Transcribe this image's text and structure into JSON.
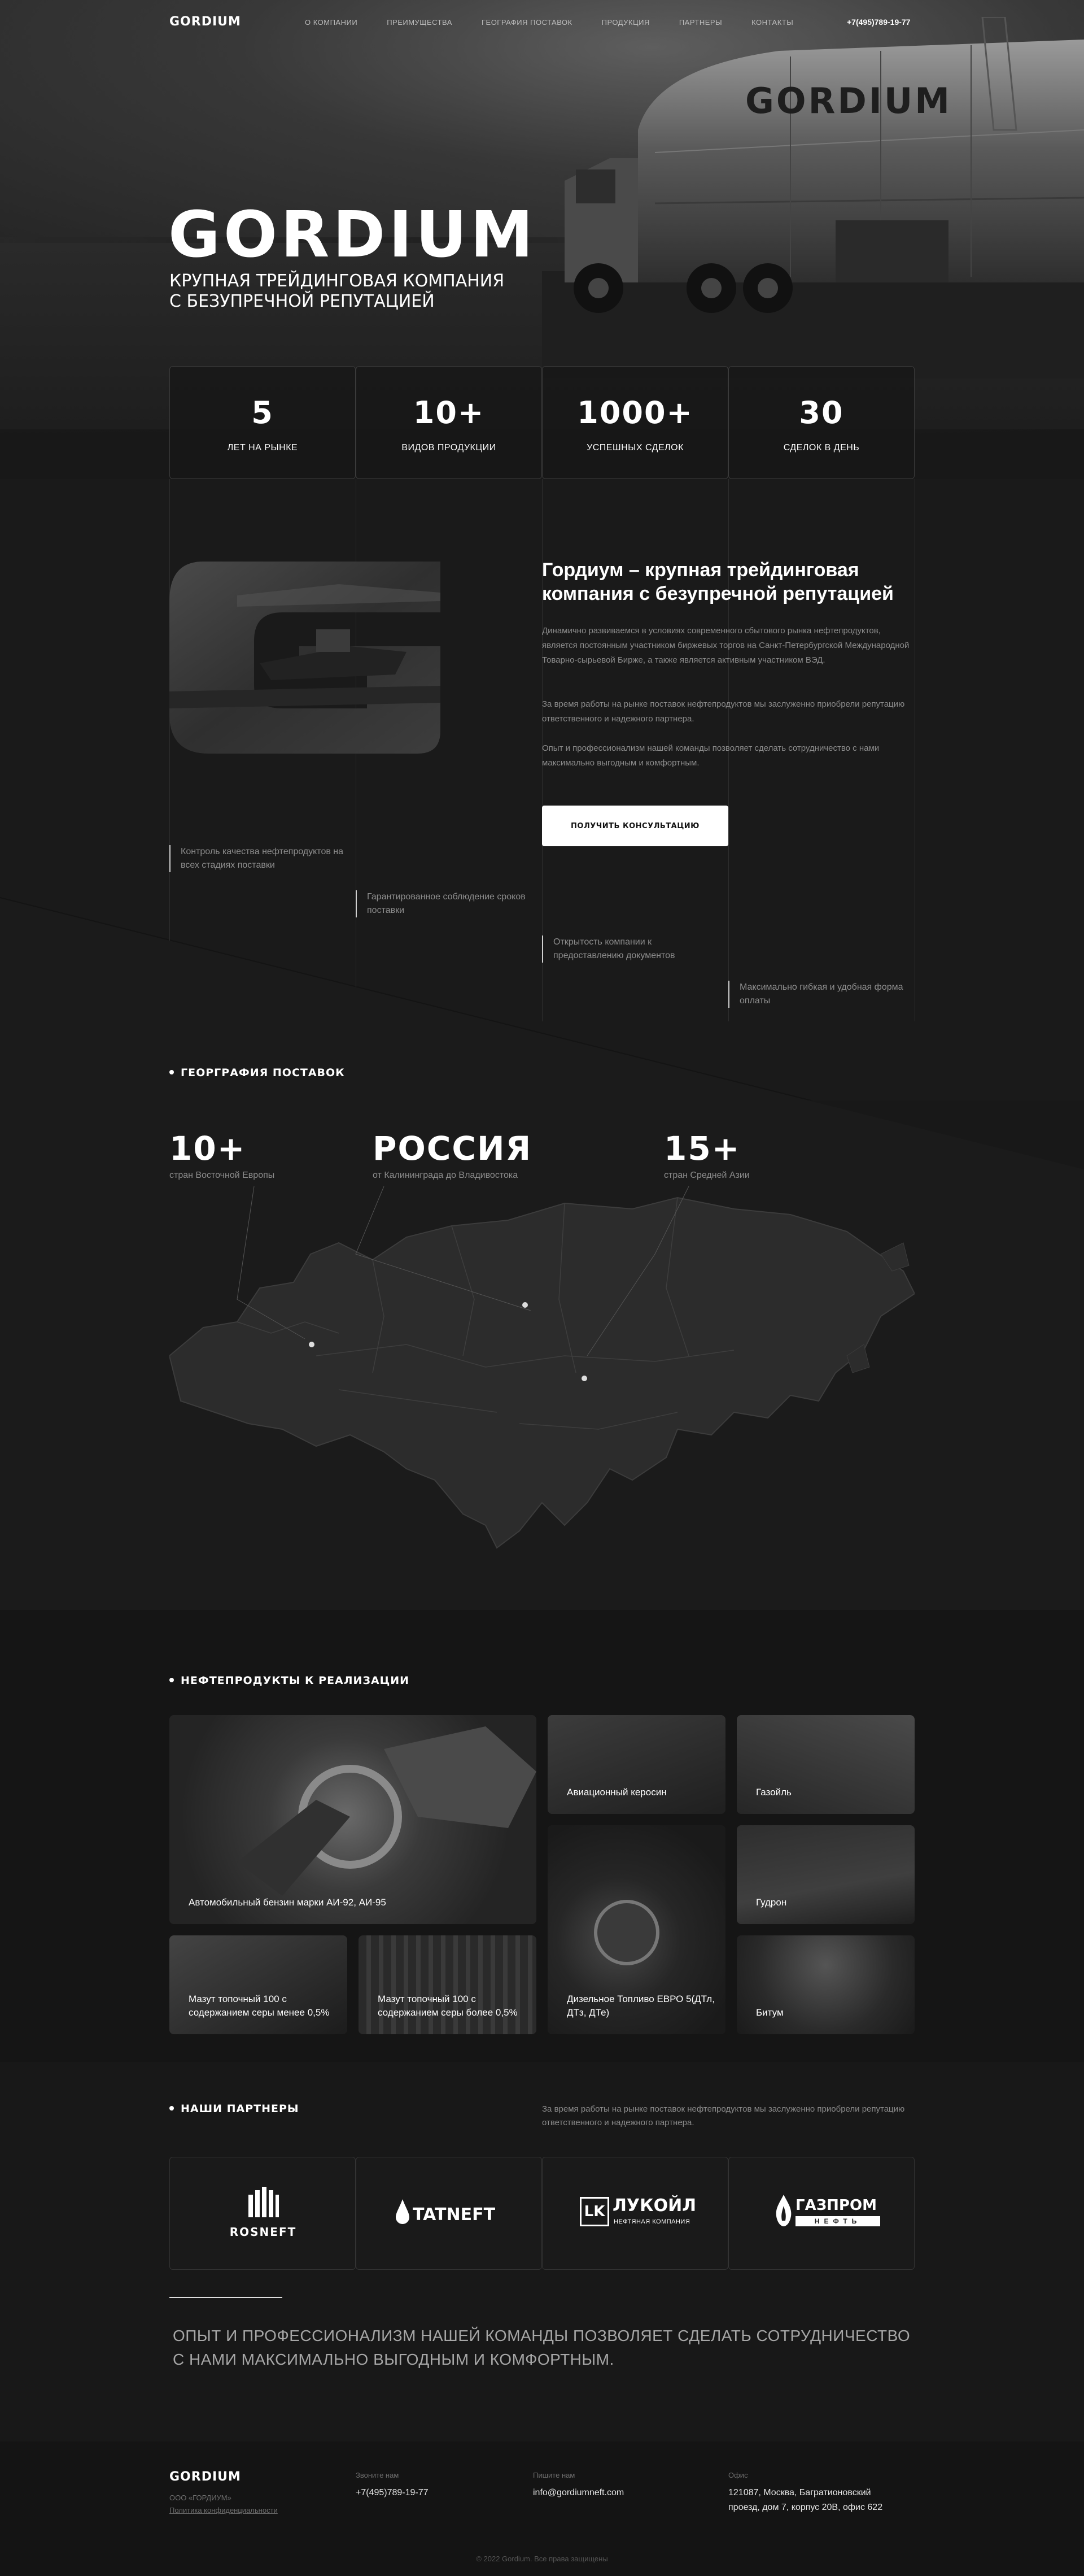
{
  "nav": {
    "logo": "GORDIUM",
    "items": [
      "О КОМПАНИИ",
      "ПРЕИМУЩЕСТВА",
      "ГЕОГРАФИЯ ПОСТАВОК",
      "ПРОДУКЦИЯ",
      "ПАРТНЕРЫ",
      "КОНТАКТЫ"
    ],
    "phone": "+7(495)789-19-77"
  },
  "hero": {
    "title": "GORDIUM",
    "subtitle_line1": "КРУПНАЯ ТРЕЙДИНГОВАЯ КОМПАНИЯ",
    "subtitle_line2": "С БЕЗУПРЕЧНОЙ РЕПУТАЦИЕЙ",
    "truck_brand": "GORDIUM"
  },
  "stats": [
    {
      "value": "5",
      "label": "ЛЕТ НА РЫНКЕ"
    },
    {
      "value": "10+",
      "label": "ВИДОВ ПРОДУКЦИИ"
    },
    {
      "value": "1000+",
      "label": "УСПЕШНЫХ СДЕЛОК"
    },
    {
      "value": "30",
      "label": "СДЕЛОК В ДЕНЬ"
    }
  ],
  "about": {
    "title": "Гордиум – крупная трейдинговая компания с безупречной репутацией",
    "p1": "Динамично развиваемся в условиях современного сбытового рынка нефтепродуктов, является постоянным участником биржевых торгов на Санкт-Петербургской Международной Товарно-сырьевой Бирже, а также является активным участником ВЭД.",
    "p2": "За время работы на рынке поставок нефтепродуктов мы заслуженно приобрели репутацию ответственного и надежного партнера.",
    "p3": "Опыт и профессионализм нашей команды позволяет сделать сотрудничество с нами максимально выгодным и комфортным.",
    "button": "ПОЛУЧИТЬ КОНСУЛЬТАЦИЮ"
  },
  "features": [
    "Контроль качества нефтепродуктов на всех стадиях поставки",
    "Гарантированное соблюдение сроков поставки",
    "Открытость компании к предоставлению документов",
    "Максимально гибкая и удобная форма оплаты"
  ],
  "geography": {
    "title": "ГЕОРГРАФИЯ ПОСТАВОК",
    "items": [
      {
        "value": "10+",
        "caption": "стран Восточной Европы"
      },
      {
        "value": "РОССИЯ",
        "caption": "от Калининграда до Владивостока"
      },
      {
        "value": "15+",
        "caption": "стран Средней Азии"
      }
    ]
  },
  "products": {
    "title": "НЕФТЕПРОДУКТЫ К РЕАЛИЗАЦИИ",
    "items": [
      "Автомобильный бензин марки АИ-92, АИ-95",
      "Авиационный керосин",
      "Газойль",
      "Гудрон",
      "Мазут топочный 100 с содержанием серы менее 0,5%",
      "Мазут топочный 100 с содержанием серы более 0,5%",
      "Дизельное Топливо ЕВРО 5(ДТл, ДТз, ДТе)",
      "Битум"
    ]
  },
  "partners": {
    "title": "НАШИ ПАРТНЕРЫ",
    "description": "За время работы на рынке поставок нефтепродуктов мы заслуженно приобрели репутацию ответственного и надежного партнера.",
    "logos": [
      {
        "name": "ROSNEFT"
      },
      {
        "name": "TATNEFT"
      },
      {
        "name": "ЛУКОЙЛ",
        "sub": "НЕФТЯНАЯ КОМПАНИЯ"
      },
      {
        "name": "ГАЗПРОМ",
        "sub": "НЕФТЬ"
      }
    ]
  },
  "quote": "ОПЫТ И ПРОФЕССИОНАЛИЗМ НАШЕЙ КОМАНДЫ ПОЗВОЛЯЕТ СДЕЛАТЬ СОТРУДНИЧЕСТВО С НАМИ МАКСИМАЛЬНО ВЫГОДНЫМ И КОМФОРТНЫМ.",
  "footer": {
    "logo": "GORDIUM",
    "company": "ООО «ГОРДИУМ»",
    "privacy": "Политика конфиденциальности",
    "call_label": "Звоните нам",
    "phone": "+7(495)789-19-77",
    "write_label": "Пишите нам",
    "email": "info@gordiumneft.com",
    "office_label": "Офис",
    "address_line1": "121087, Москва, Багратионовский",
    "address_line2": "проезд,  дом 7, корпус 20В, офис 622",
    "copyright": "© 2022 Gordium. Все права защищены"
  },
  "colors": {
    "background": "#181818",
    "accent": "#ffffff",
    "muted_text": "#8c8c8c"
  }
}
